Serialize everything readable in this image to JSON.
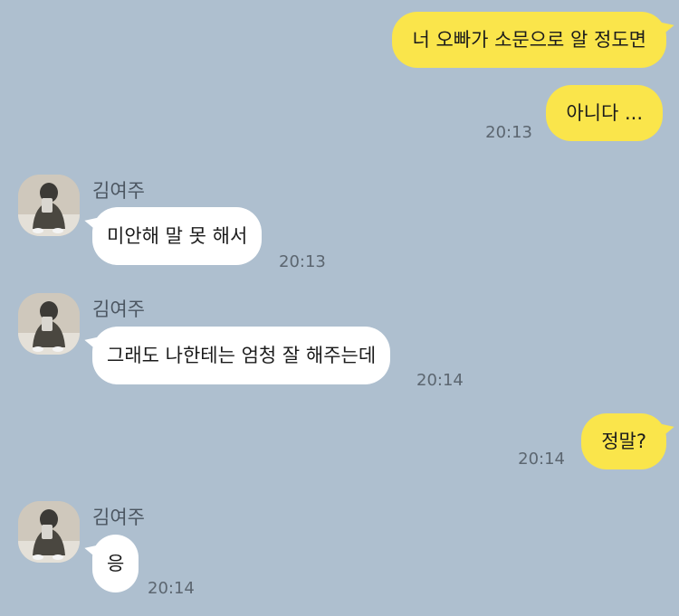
{
  "messages": [
    {
      "type": "out",
      "text": "너 오빠가 소문으로 알 정도면"
    },
    {
      "type": "out",
      "text": "아니다 ...",
      "time": "20:13"
    },
    {
      "type": "in",
      "sender": "김여주",
      "text": "미안해 말 못 해서",
      "time": "20:13",
      "avatar_icon": "profile-photo-icon"
    },
    {
      "type": "in",
      "sender": "김여주",
      "text": "그래도 나한테는 엄청 잘 해주는데",
      "time": "20:14",
      "avatar_icon": "profile-photo-icon"
    },
    {
      "type": "out",
      "text": "정말?",
      "time": "20:14"
    },
    {
      "type": "in",
      "sender": "김여주",
      "text": "응",
      "time": "20:14",
      "avatar_icon": "profile-photo-icon"
    }
  ],
  "colors": {
    "background": "#aebfcf",
    "outgoing_bubble": "#fae54b",
    "incoming_bubble": "#ffffff"
  }
}
